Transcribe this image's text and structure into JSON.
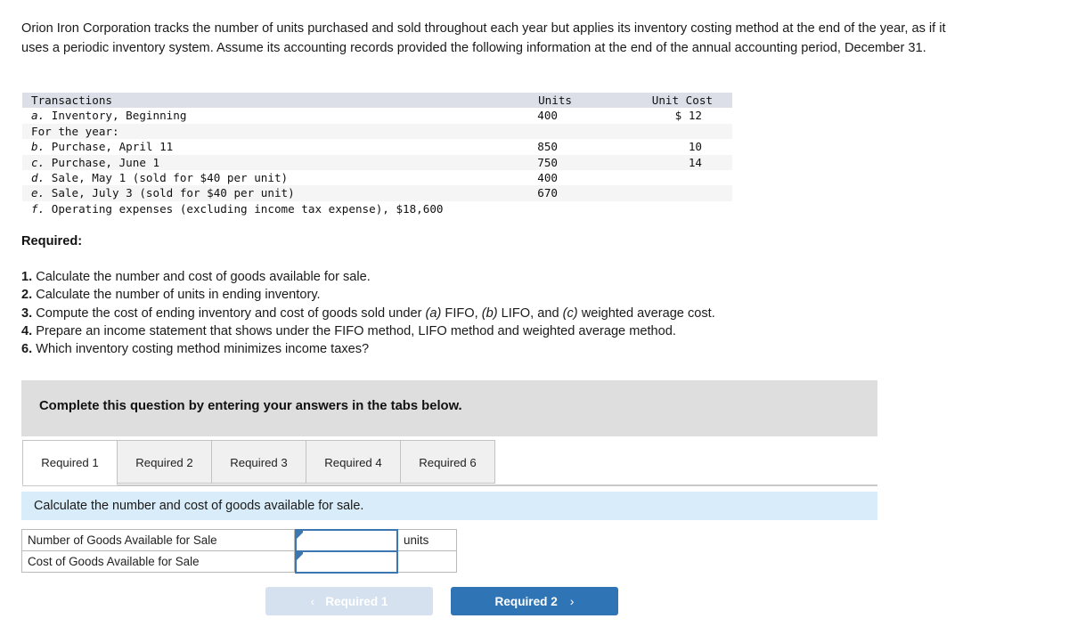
{
  "intro": {
    "paragraph": "Orion Iron Corporation tracks the number of units purchased and sold throughout each year but applies its inventory costing method at the end of the year, as if it uses a periodic inventory system. Assume its accounting records provided the following information at the end of the annual accounting period, December 31."
  },
  "transactions_table": {
    "columns": [
      "Transactions",
      "Units",
      "Unit Cost"
    ],
    "rows": [
      {
        "letter": "a.",
        "desc": "Inventory, Beginning",
        "units": "400",
        "cost": "$ 12"
      },
      {
        "letter": "",
        "desc": "For the year:",
        "units": "",
        "cost": ""
      },
      {
        "letter": "b.",
        "desc": "Purchase, April 11",
        "units": "850",
        "cost": "10"
      },
      {
        "letter": "c.",
        "desc": "Purchase, June 1",
        "units": "750",
        "cost": "14"
      },
      {
        "letter": "d.",
        "desc": "Sale, May 1 (sold for $40 per unit)",
        "units": "400",
        "cost": ""
      },
      {
        "letter": "e.",
        "desc": "Sale, July 3 (sold for $40 per unit)",
        "units": "670",
        "cost": ""
      },
      {
        "letter": "f.",
        "desc": "Operating expenses (excluding income tax expense), $18,600",
        "units": "",
        "cost": ""
      }
    ]
  },
  "required": {
    "heading": "Required:",
    "items": [
      {
        "num": "1.",
        "pre": "Calculate the number and cost of goods available for sale.",
        "em1": "",
        "mid1": "",
        "em2": "",
        "mid2": "",
        "em3": "",
        "post": ""
      },
      {
        "num": "2.",
        "pre": "Calculate the number of units in ending inventory.",
        "em1": "",
        "mid1": "",
        "em2": "",
        "mid2": "",
        "em3": "",
        "post": ""
      },
      {
        "num": "3.",
        "pre": "Compute the cost of ending inventory and cost of goods sold under ",
        "em1": "(a)",
        "mid1": " FIFO, ",
        "em2": "(b)",
        "mid2": " LIFO, and ",
        "em3": "(c)",
        "post": " weighted average cost."
      },
      {
        "num": "4.",
        "pre": "Prepare an income statement that shows under the FIFO method, LIFO method and weighted average method.",
        "em1": "",
        "mid1": "",
        "em2": "",
        "mid2": "",
        "em3": "",
        "post": ""
      },
      {
        "num": "6.",
        "pre": "Which inventory costing method minimizes income taxes?",
        "em1": "",
        "mid1": "",
        "em2": "",
        "mid2": "",
        "em3": "",
        "post": ""
      }
    ]
  },
  "banner": {
    "text": "Complete this question by entering your answers in the tabs below."
  },
  "tabs": {
    "items": [
      {
        "label": "Required 1",
        "active": true
      },
      {
        "label": "Required 2",
        "active": false
      },
      {
        "label": "Required 3",
        "active": false
      },
      {
        "label": "Required 4",
        "active": false
      },
      {
        "label": "Required 6",
        "active": false
      }
    ]
  },
  "subheader": {
    "text": "Calculate the number and cost of goods available for sale."
  },
  "answer_table": {
    "rows": [
      {
        "label": "Number of Goods Available for Sale",
        "value": "",
        "unit": "units"
      },
      {
        "label": "Cost of Goods Available for Sale",
        "value": "",
        "unit": ""
      }
    ]
  },
  "navigation": {
    "prev_label": "Required 1",
    "prev_chevron": "‹",
    "next_label": "Required 2",
    "next_chevron": "›"
  },
  "colors": {
    "accent_blue": "#2f74b5",
    "disabled_blue": "#d5e1ee",
    "input_border": "#3c77b0",
    "subheader_blue": "#d9ecf9",
    "banner_gray": "#dedede",
    "table_header": "#dcdfe8",
    "table_stripe": "#f5f5f5"
  }
}
